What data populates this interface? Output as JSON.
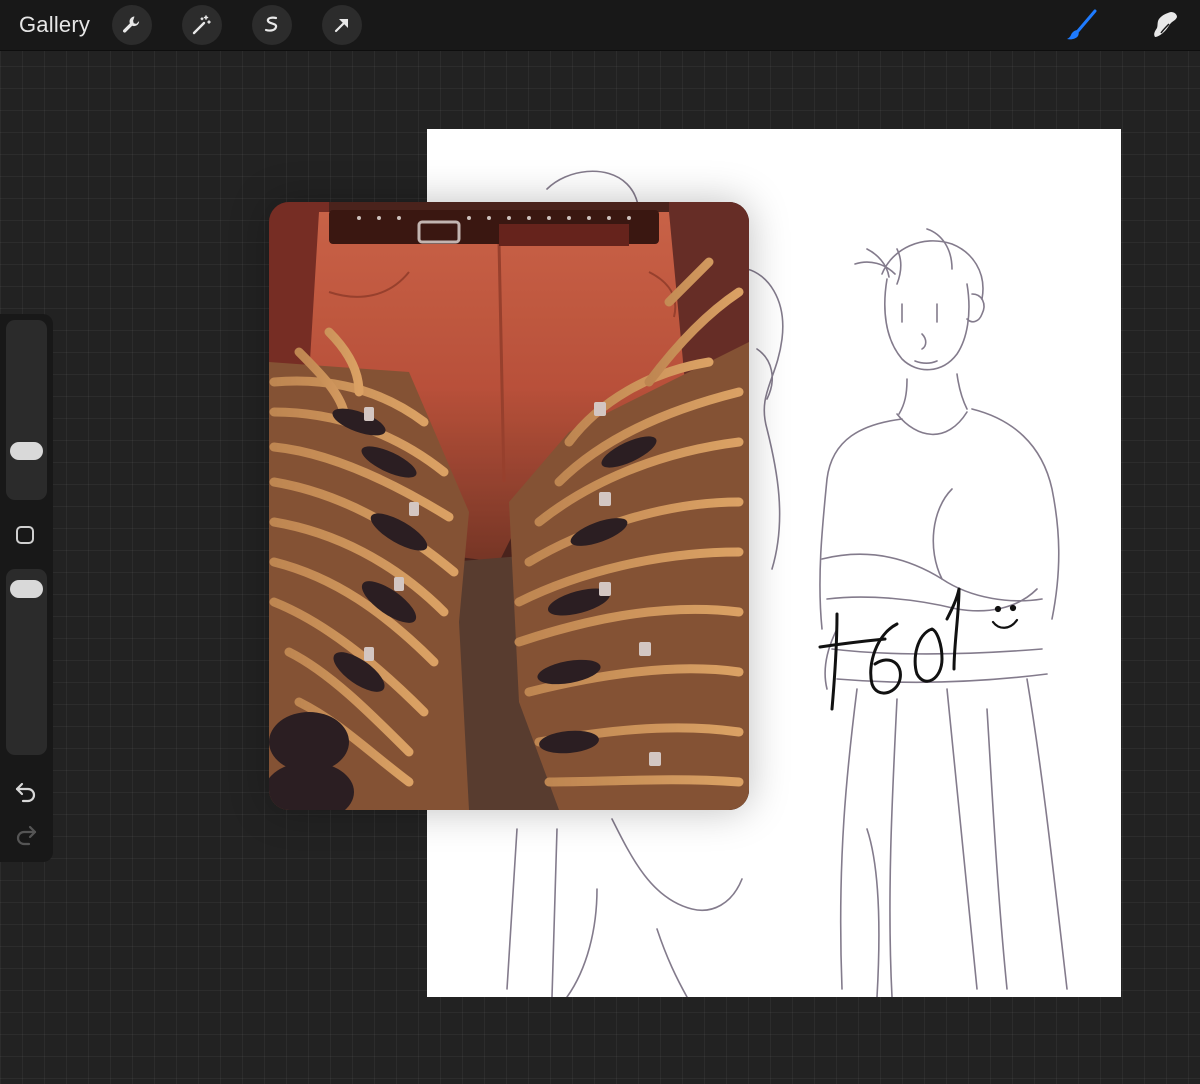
{
  "topbar": {
    "gallery_label": "Gallery",
    "tools_left": [
      "wrench-icon",
      "magic-wand-icon",
      "selection-icon",
      "transform-arrow-icon"
    ],
    "tools_right": [
      "brush-icon",
      "smudge-icon"
    ],
    "accent_color": "#1e7bff"
  },
  "sidebar": {
    "brush_size_level": 0.4,
    "opacity_level": 0.95,
    "icons": [
      "modify-square-icon",
      "undo-icon",
      "redo-icon"
    ]
  },
  "canvas": {
    "handwriting": "+601",
    "doodle": "smiley-face"
  },
  "reference_photo": {
    "subject": "leather-belt-covered-pants"
  }
}
